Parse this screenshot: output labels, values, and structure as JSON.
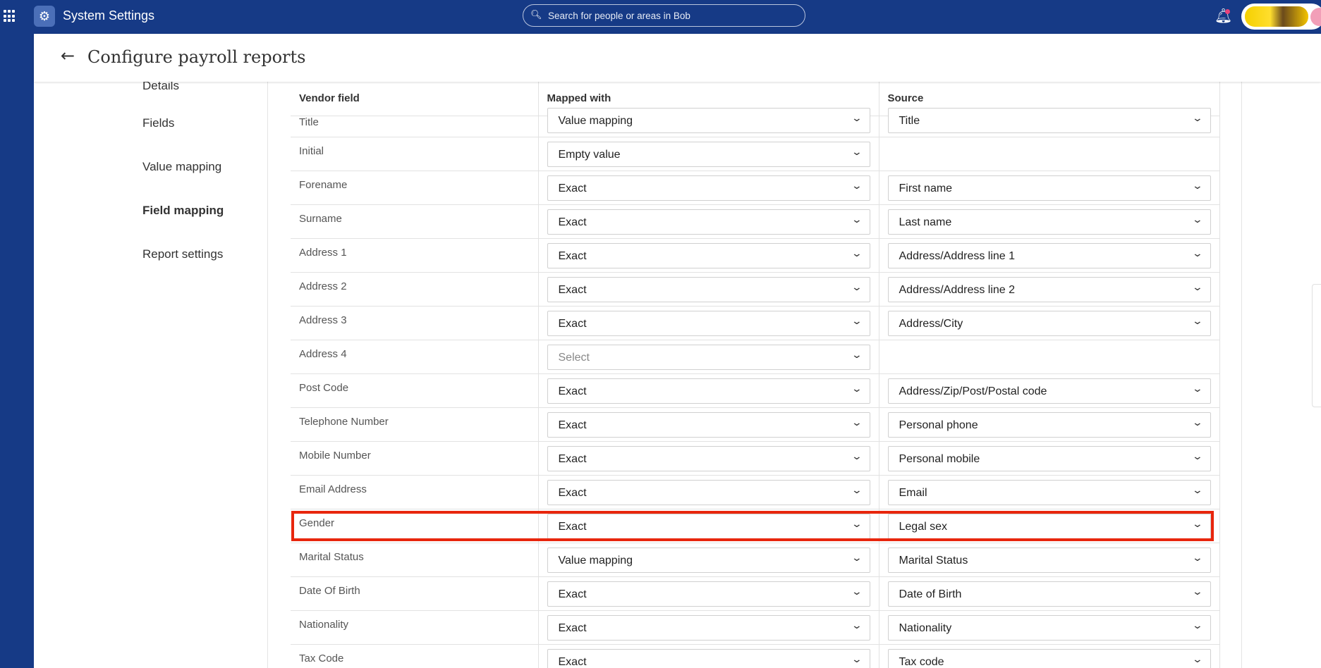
{
  "topbar": {
    "app_title": "System Settings",
    "search_placeholder": "Search for people or areas in Bob",
    "notification_badge_color": "#e9427a"
  },
  "colors": {
    "brand": "#163a86",
    "highlight": "#e8260d"
  },
  "page": {
    "title": "Configure payroll reports"
  },
  "nav": {
    "items": [
      {
        "label": "Details"
      },
      {
        "label": "Fields"
      },
      {
        "label": "Value mapping"
      },
      {
        "label": "Field mapping"
      },
      {
        "label": "Report settings"
      }
    ],
    "active": "Field mapping"
  },
  "table": {
    "headers": [
      "Vendor field",
      "Mapped with",
      "Source"
    ],
    "rows": [
      {
        "vendor": "Title",
        "mapped": "Value mapping",
        "source": "Title"
      },
      {
        "vendor": "Initial",
        "mapped": "Empty value",
        "source": ""
      },
      {
        "vendor": "Forename",
        "mapped": "Exact",
        "source": "First name"
      },
      {
        "vendor": "Surname",
        "mapped": "Exact",
        "source": "Last name"
      },
      {
        "vendor": "Address 1",
        "mapped": "Exact",
        "source": "Address/Address line 1"
      },
      {
        "vendor": "Address 2",
        "mapped": "Exact",
        "source": "Address/Address line 2"
      },
      {
        "vendor": "Address 3",
        "mapped": "Exact",
        "source": "Address/City"
      },
      {
        "vendor": "Address 4",
        "mapped": "Select",
        "source": ""
      },
      {
        "vendor": "Post Code",
        "mapped": "Exact",
        "source": "Address/Zip/Post/Postal code"
      },
      {
        "vendor": "Telephone Number",
        "mapped": "Exact",
        "source": "Personal phone"
      },
      {
        "vendor": "Mobile Number",
        "mapped": "Exact",
        "source": "Personal mobile"
      },
      {
        "vendor": "Email Address",
        "mapped": "Exact",
        "source": "Email"
      },
      {
        "vendor": "Gender",
        "mapped": "Exact",
        "source": "Legal sex"
      },
      {
        "vendor": "Marital Status",
        "mapped": "Value mapping",
        "source": "Marital Status"
      },
      {
        "vendor": "Date Of Birth",
        "mapped": "Exact",
        "source": "Date of Birth"
      },
      {
        "vendor": "Nationality",
        "mapped": "Exact",
        "source": "Nationality"
      },
      {
        "vendor": "Tax Code",
        "mapped": "Exact",
        "source": "Tax code"
      }
    ]
  }
}
